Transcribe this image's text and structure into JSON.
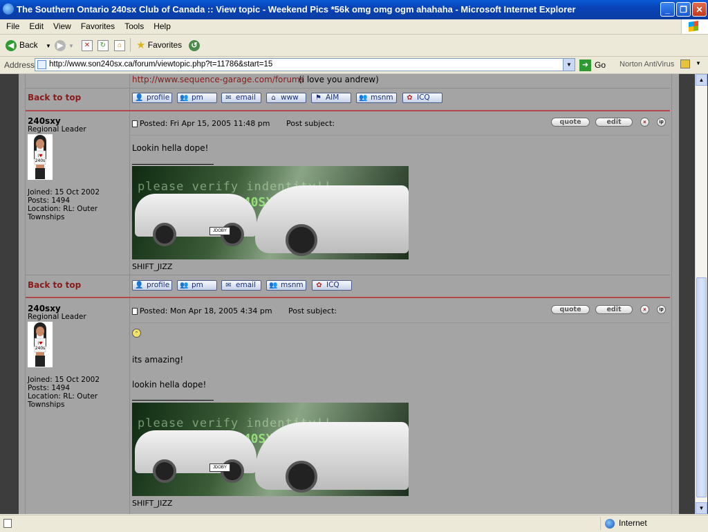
{
  "window": {
    "title": "The Southern Ontario 240sx Club of Canada :: View topic - Weekend Pics *56k omg omg ogm ahahaha - Microsoft Internet Explorer",
    "minimize": "_",
    "maximize": "❐",
    "close": "✕"
  },
  "menu": [
    "File",
    "Edit",
    "View",
    "Favorites",
    "Tools",
    "Help"
  ],
  "toolbar": {
    "back_label": "Back",
    "favorites_label": "Favorites"
  },
  "address": {
    "label": "Address",
    "url": "http://www.son240sx.ca/forum/viewtopic.php?t=11786&start=15",
    "go_label": "Go",
    "norton_label": "Norton AntiVirus"
  },
  "top_partial": {
    "sig_link": "http://www.sequence-garage.com/forums",
    "sig_text": " (i love you andrew)",
    "back_to_top": "Back to top",
    "buttons": [
      "profile",
      "pm",
      "email",
      "www",
      "AIM",
      "msnm",
      "ICQ"
    ]
  },
  "posts": [
    {
      "username": "240sxy",
      "rank": "Regional Leader",
      "joined": "Joined: 15 Oct 2002",
      "posts": "Posts: 1494",
      "location": "Location: RL: Outer Townships",
      "posted": "Posted: Fri Apr 15, 2005 11:48 pm",
      "subject": "Post subject:",
      "body": [
        "Lookin hella dope!"
      ],
      "signature_text": "SHIFT_JIZZ",
      "back_to_top": "Back to top",
      "buttons": [
        "profile",
        "pm",
        "email",
        "msnm",
        "ICQ"
      ]
    },
    {
      "username": "240sxy",
      "rank": "Regional Leader",
      "joined": "Joined: 15 Oct 2002",
      "posts": "Posts: 1494",
      "location": "Location: RL: Outer Townships",
      "posted": "Posted: Mon Apr 18, 2005 4:34 pm",
      "subject": "Post subject:",
      "body": [
        "its amazing!",
        "lookin hella dope!"
      ],
      "signature_text": "SHIFT_JIZZ"
    }
  ],
  "post_actions": {
    "quote": "quote",
    "edit": "edit",
    "delete": "×",
    "ip": "ip"
  },
  "banner": {
    "line1": "please verify indentity!!",
    "line2": "240SXY...",
    "plate": "JDOBY"
  },
  "avatar_text": "I♥ 240s",
  "status": {
    "zone": "Internet"
  }
}
